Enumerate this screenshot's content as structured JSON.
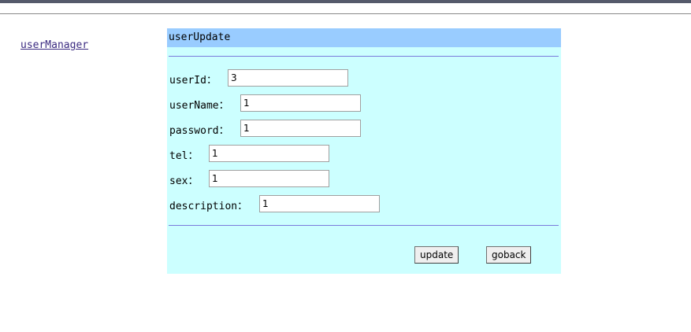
{
  "nav": {
    "link_label": "userManager"
  },
  "form": {
    "title": "userUpdate",
    "fields": [
      {
        "label": "userId：",
        "value": "3"
      },
      {
        "label": "userName：",
        "value": "1"
      },
      {
        "label": "password：",
        "value": "1"
      },
      {
        "label": "tel：",
        "value": "1"
      },
      {
        "label": "sex：",
        "value": "1"
      },
      {
        "label": "description：",
        "value": "1"
      }
    ],
    "update_label": "update",
    "goback_label": "goback"
  },
  "colors": {
    "panel_bg": "#ccffff",
    "header_bg": "#99ccff",
    "rule": "#7a7adb",
    "link": "#3a2a80"
  }
}
